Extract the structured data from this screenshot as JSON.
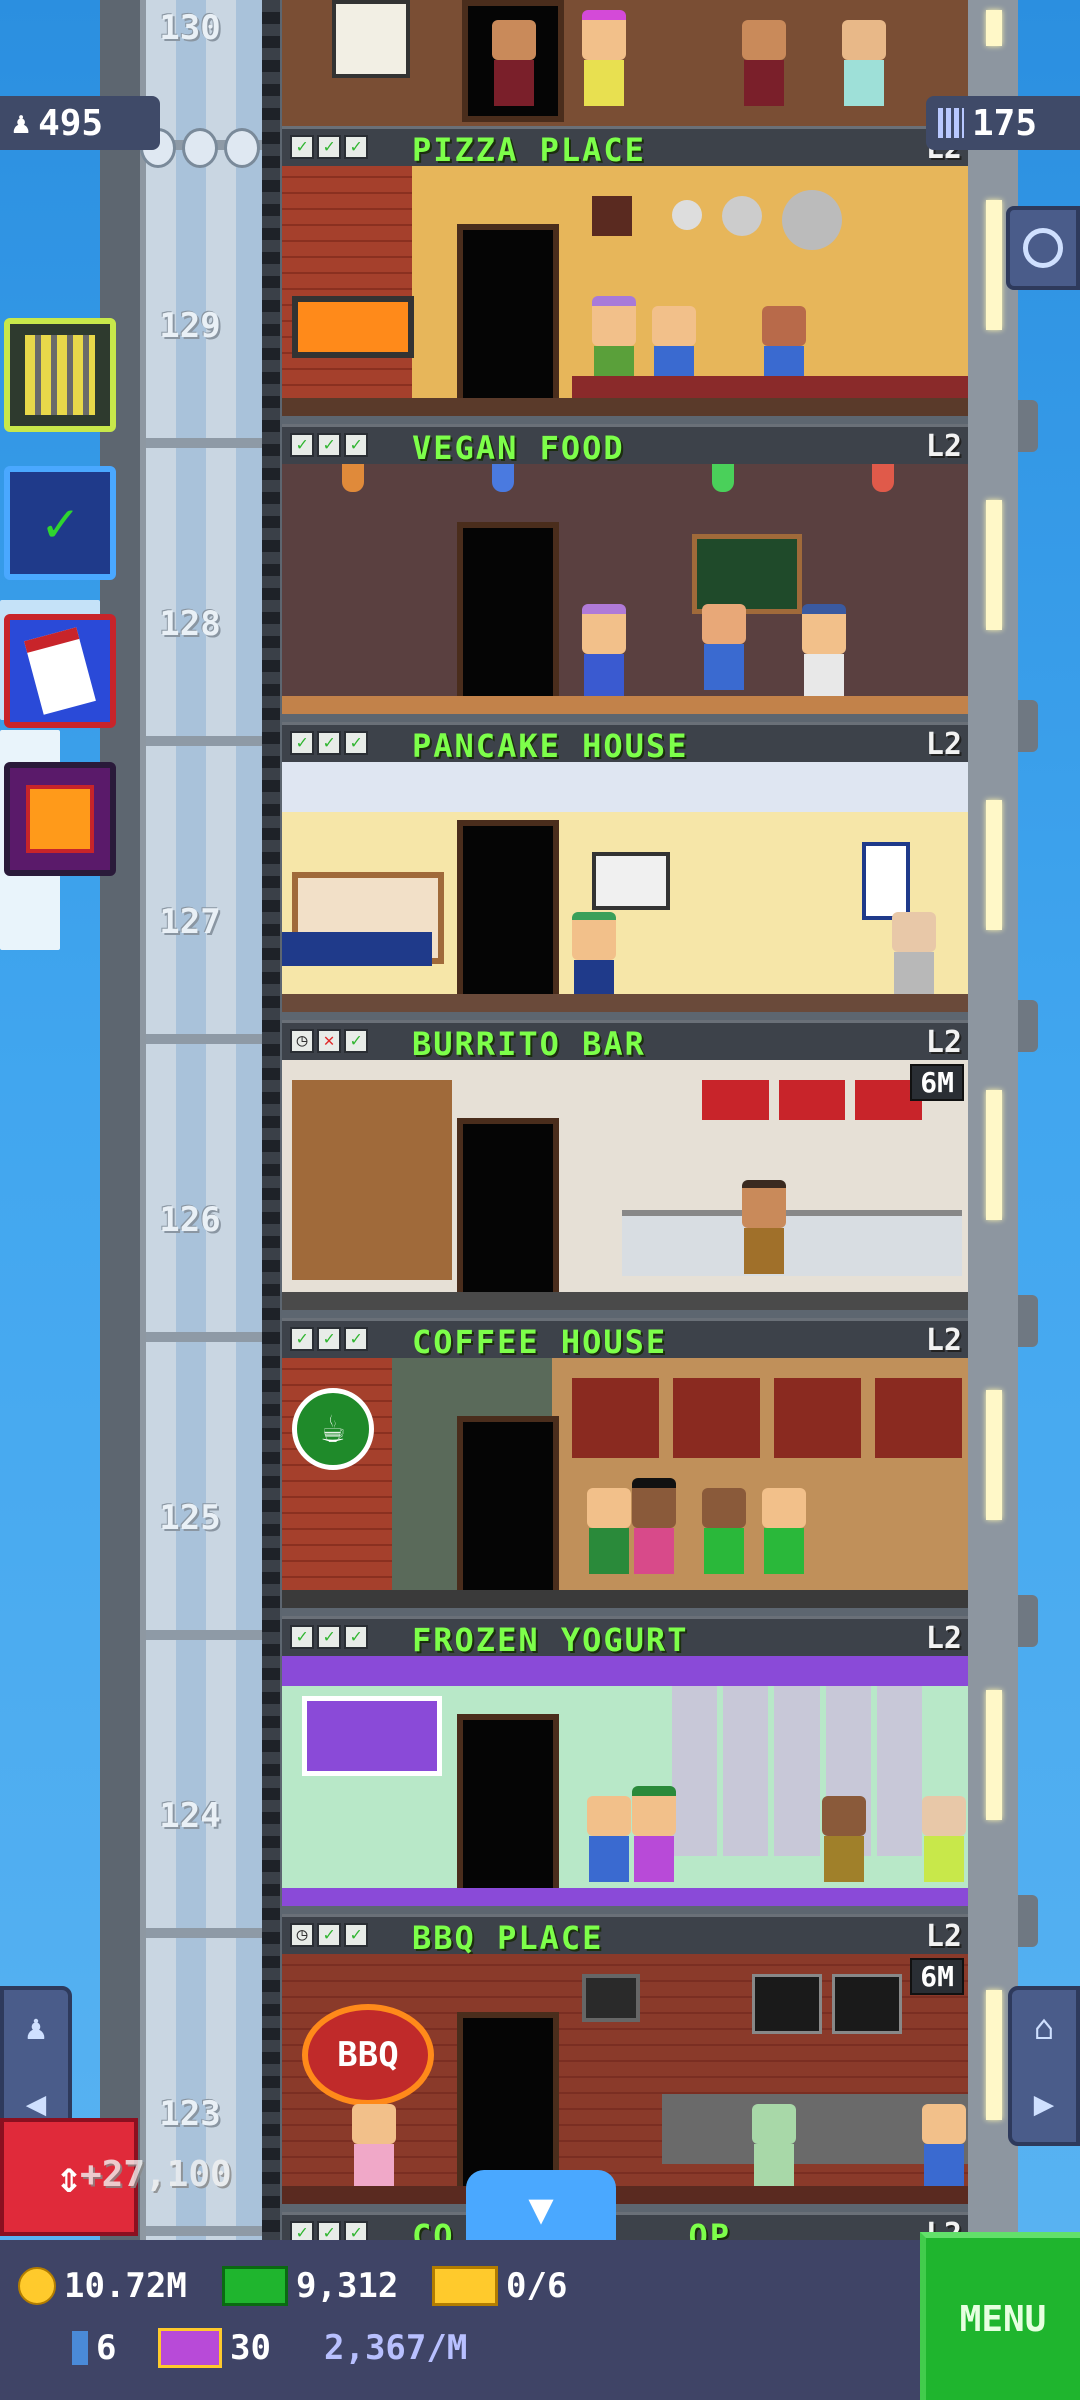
{
  "colors": {
    "label_green": "#7dff4a",
    "sky": "#41a6ef",
    "menu": "#1fb52e"
  },
  "hud": {
    "population": "495",
    "bux_or_floors": "175"
  },
  "floor_numbers": [
    "130",
    "129",
    "128",
    "127",
    "126",
    "125",
    "124",
    "123"
  ],
  "floors": [
    {
      "name": "PIZZA PLACE",
      "level": "L2",
      "status": [
        "ok",
        "ok",
        "ok"
      ],
      "timer": ""
    },
    {
      "name": "VEGAN FOOD",
      "level": "L2",
      "status": [
        "ok",
        "ok",
        "ok"
      ],
      "timer": ""
    },
    {
      "name": "PANCAKE HOUSE",
      "level": "L2",
      "status": [
        "ok",
        "ok",
        "ok"
      ],
      "timer": ""
    },
    {
      "name": "BURRITO BAR",
      "level": "L2",
      "status": [
        "clock",
        "bad",
        "ok"
      ],
      "timer": "6M"
    },
    {
      "name": "COFFEE HOUSE",
      "level": "L2",
      "status": [
        "ok",
        "ok",
        "ok"
      ],
      "timer": ""
    },
    {
      "name": "FROZEN YOGURT",
      "level": "L2",
      "status": [
        "ok",
        "ok",
        "ok"
      ],
      "timer": ""
    },
    {
      "name": "BBQ PLACE",
      "level": "L2",
      "status": [
        "clock",
        "ok",
        "ok"
      ],
      "timer": "6M"
    },
    {
      "name": "CO___________OP",
      "level": "L2",
      "status": [
        "ok",
        "ok",
        "ok"
      ],
      "timer": ""
    }
  ],
  "signs": {
    "bbq": "BBQ"
  },
  "elevator_reward": "+27,100",
  "bottom": {
    "coins": "10.72M",
    "bux": "9,312",
    "tickets": "0/6",
    "keys": "6",
    "vip": "30",
    "rate": "2,367/M",
    "menu_label": "MENU"
  }
}
